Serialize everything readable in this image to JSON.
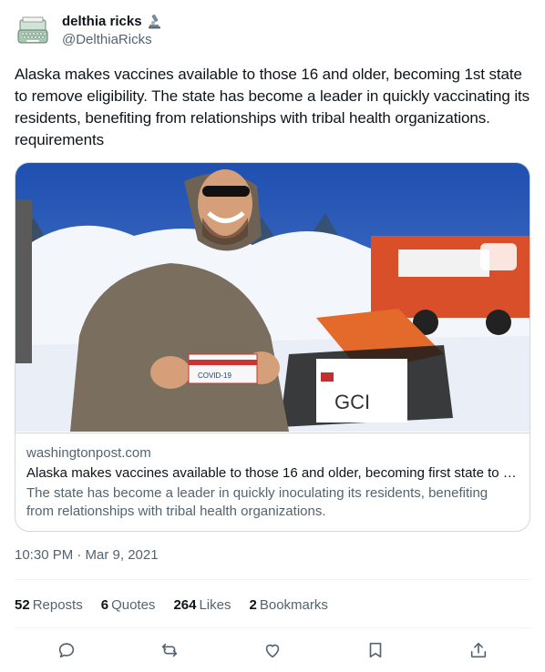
{
  "author": {
    "display_name": "delthia ricks",
    "handle": "@DelthiaRicks",
    "avatar_icon": "typewriter-icon",
    "badge_icon": "microscope-icon"
  },
  "tweet": {
    "text": "Alaska makes vaccines available to those 16 and older, becoming 1st state to remove eligibility. The state has become a leader in quickly vaccinating its residents, benefiting from relationships with tribal health organizations. requirements"
  },
  "card": {
    "domain": "washingtonpost.com",
    "title": "Alaska makes vaccines available to those 16 and older, becoming first state to remove eligibility requirements",
    "description": "The state has become a leader in quickly inoculating its residents, benefiting from relationships with tribal health organizations.",
    "image_labels": {
      "vaccine_box": "COVID-19",
      "banner": "GCI"
    }
  },
  "timestamp": "10:30 PM · Mar 9, 2021",
  "stats": {
    "reposts": {
      "count": "52",
      "label": "Reposts"
    },
    "quotes": {
      "count": "6",
      "label": "Quotes"
    },
    "likes": {
      "count": "264",
      "label": "Likes"
    },
    "bookmarks": {
      "count": "2",
      "label": "Bookmarks"
    }
  },
  "actions": [
    "reply-icon",
    "repost-icon",
    "like-icon",
    "bookmark-icon",
    "share-icon"
  ],
  "colors": {
    "text": "#0f1419",
    "secondary": "#536471",
    "border": "#cfd9de",
    "divider": "#eff3f4"
  }
}
